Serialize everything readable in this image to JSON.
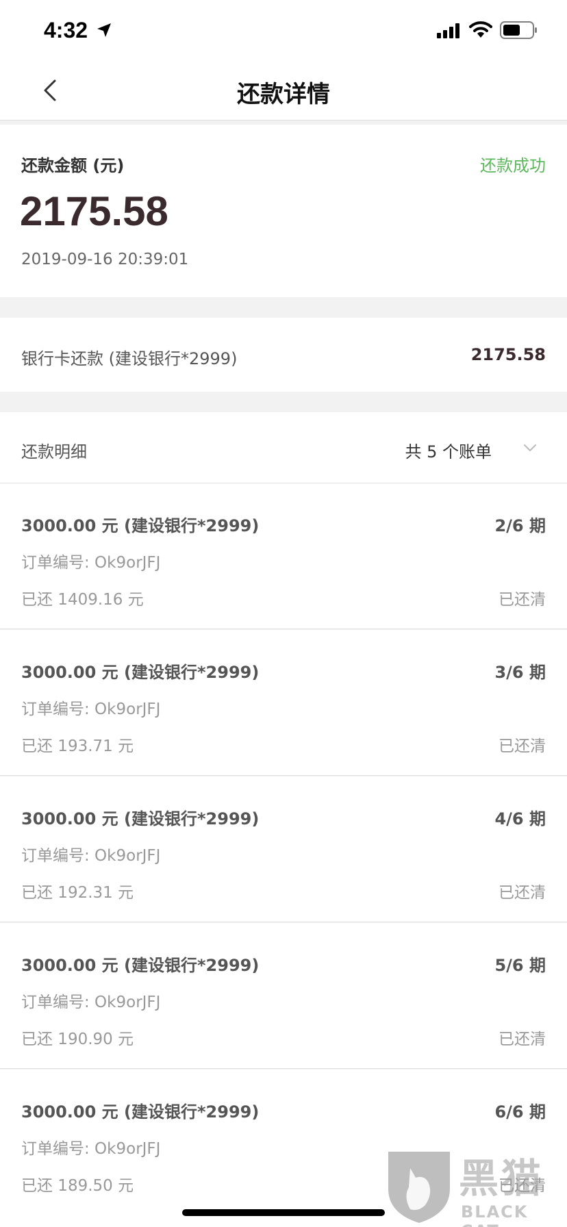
{
  "status_bar": {
    "time": "4:32"
  },
  "nav": {
    "title": "还款详情"
  },
  "amount": {
    "label": "还款金额 (元)",
    "status": "还款成功",
    "value": "2175.58",
    "time": "2019-09-16 20:39:01"
  },
  "bank": {
    "label": "银行卡还款 (建设银行*2999)",
    "amount": "2175.58"
  },
  "detail": {
    "label": "还款明细",
    "count": "共 5 个账单"
  },
  "bills": [
    {
      "title": "3000.00 元 (建设银行*2999)",
      "period": "2/6 期",
      "order": "订单编号: Ok9orJFJ",
      "paid": "已还 1409.16 元",
      "state": "已还清"
    },
    {
      "title": "3000.00 元 (建设银行*2999)",
      "period": "3/6 期",
      "order": "订单编号: Ok9orJFJ",
      "paid": "已还 193.71 元",
      "state": "已还清"
    },
    {
      "title": "3000.00 元 (建设银行*2999)",
      "period": "4/6 期",
      "order": "订单编号: Ok9orJFJ",
      "paid": "已还 192.31 元",
      "state": "已还清"
    },
    {
      "title": "3000.00 元 (建设银行*2999)",
      "period": "5/6 期",
      "order": "订单编号: Ok9orJFJ",
      "paid": "已还 190.90 元",
      "state": "已还清"
    },
    {
      "title": "3000.00 元 (建设银行*2999)",
      "period": "6/6 期",
      "order": "订单编号: Ok9orJFJ",
      "paid": "已还 189.50 元",
      "state": "已还清"
    }
  ],
  "watermark": {
    "cn": "黑猫",
    "en": "BLACK CAT"
  },
  "colors": {
    "success": "#5cb85c",
    "amount": "#3a2a2e"
  }
}
